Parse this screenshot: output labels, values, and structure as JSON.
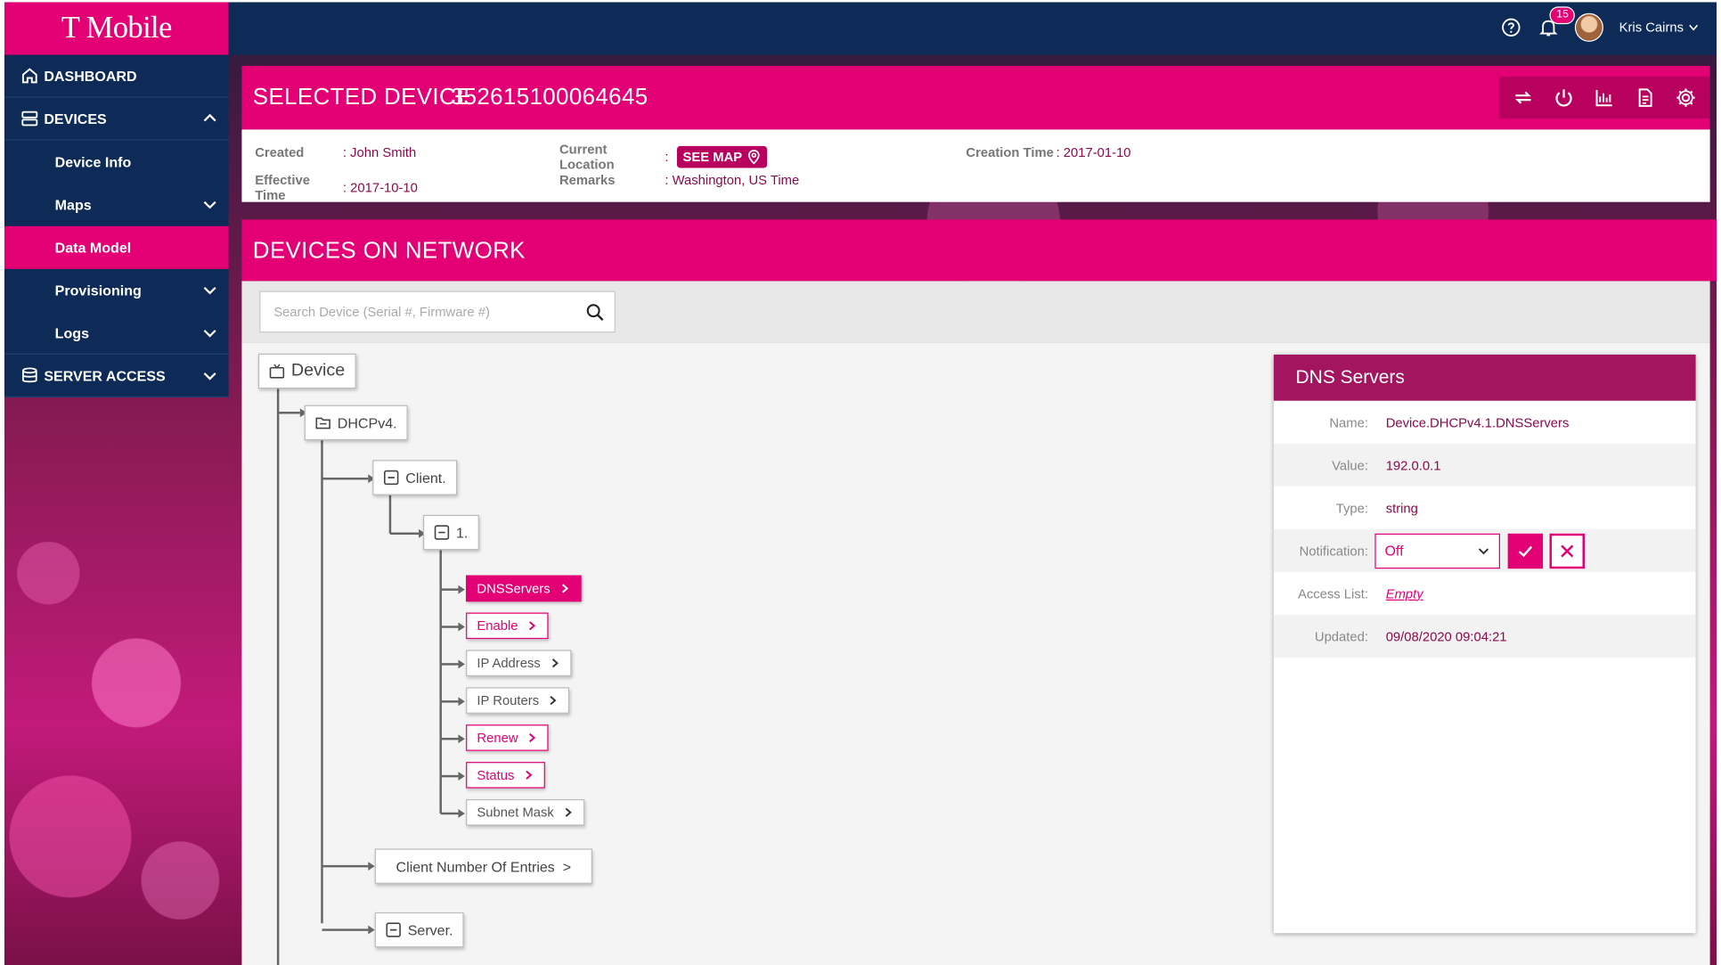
{
  "brand": {
    "logo_text": "T Mobile",
    "accent": "#e20074",
    "navy": "#0e2b57"
  },
  "sidebar": {
    "dashboard": "DASHBOARD",
    "devices": "DEVICES",
    "items": [
      {
        "label": "Device Info"
      },
      {
        "label": "Maps"
      },
      {
        "label": "Data Model"
      },
      {
        "label": "Provisioning"
      },
      {
        "label": "Logs"
      }
    ],
    "server_access": "SERVER ACCESS"
  },
  "topbar": {
    "notifications_count": "15",
    "user_name": "Kris Cairns",
    "icons": [
      "help-icon",
      "bell-icon",
      "avatar",
      "chevron-down-icon"
    ]
  },
  "selected_device": {
    "title": "SELECTED DEVICE",
    "serial": "352615100064645",
    "tools": [
      "sync-icon",
      "power-icon",
      "chart-icon",
      "document-icon",
      "gear-icon"
    ],
    "created_label": "Created",
    "created_value": ": John Smith",
    "effective_label": "Effective Time",
    "effective_value": ": 2017-10-10",
    "location_label": "Current Location",
    "location_sep": ":",
    "see_map": "SEE MAP",
    "remarks_label": "Remarks",
    "remarks_value": ": Washington, US Time",
    "creation_label": "Creation Time",
    "creation_value": ": 2017-01-10"
  },
  "network": {
    "title": "DEVICES ON NETWORK",
    "search_placeholder": "Search Device (Serial #, Firmware #)"
  },
  "tree": {
    "root": "Device",
    "dhcp": "DHCPv4.",
    "client": "Client.",
    "one": "1.",
    "leaves": [
      {
        "label": "DNSServers",
        "state": "selected"
      },
      {
        "label": "Enable",
        "state": "pink"
      },
      {
        "label": "IP Address",
        "state": "normal"
      },
      {
        "label": "IP Routers",
        "state": "normal"
      },
      {
        "label": "Renew",
        "state": "pink"
      },
      {
        "label": "Status",
        "state": "pink"
      },
      {
        "label": "Subnet Mask",
        "state": "normal"
      }
    ],
    "client_entries": "Client Number Of Entries  >",
    "server": "Server."
  },
  "detail": {
    "title": "DNS Servers",
    "name_label": "Name:",
    "name_value": "Device.DHCPv4.1.DNSServers",
    "value_label": "Value:",
    "value_value": "192.0.0.1",
    "type_label": "Type:",
    "type_value": "string",
    "notification_label": "Notification:",
    "notification_value": "Off",
    "access_label": "Access List:",
    "access_value": "Empty",
    "updated_label": "Updated:",
    "updated_value": "09/08/2020 09:04:21"
  }
}
